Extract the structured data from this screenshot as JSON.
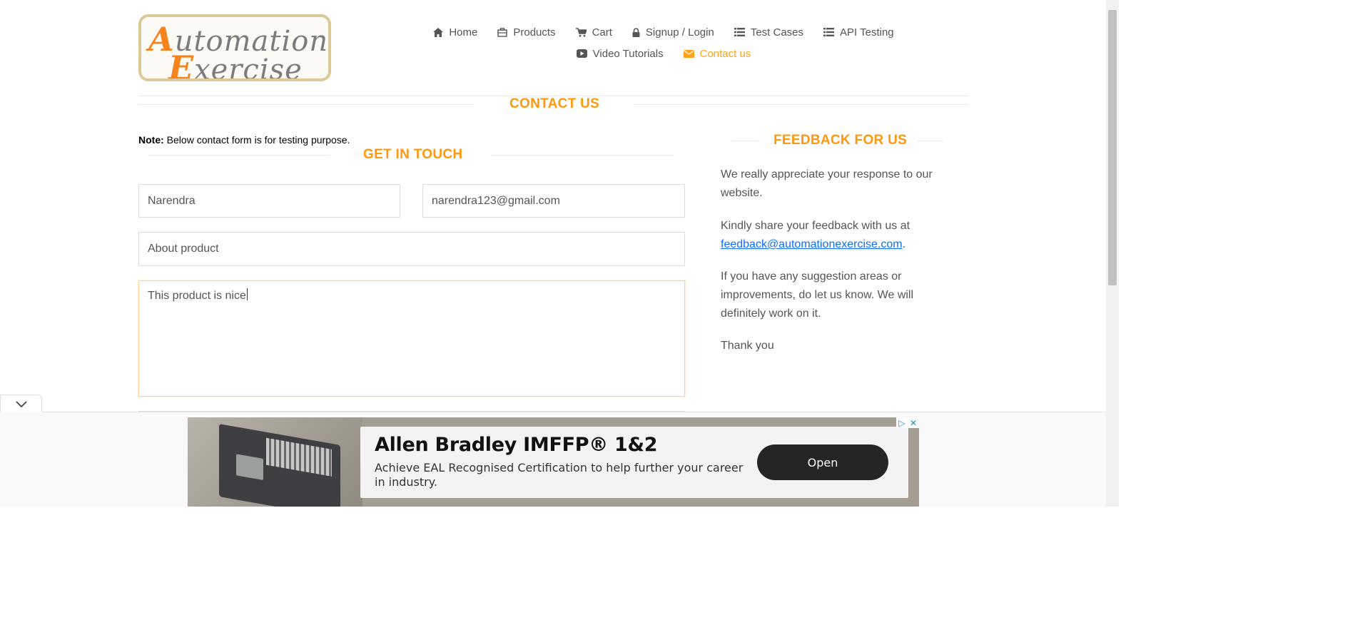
{
  "logo": {
    "line1_cap": "A",
    "line1_rest": "utomation",
    "line2_cap": "E",
    "line2_rest": "xercise"
  },
  "nav": {
    "row1": [
      {
        "label": "Home",
        "icon": "home-icon"
      },
      {
        "label": "Products",
        "icon": "products-icon"
      },
      {
        "label": "Cart",
        "icon": "cart-icon"
      },
      {
        "label": "Signup / Login",
        "icon": "lock-icon"
      },
      {
        "label": "Test Cases",
        "icon": "list-icon"
      },
      {
        "label": "API Testing",
        "icon": "list-icon"
      }
    ],
    "row2": [
      {
        "label": "Video Tutorials",
        "icon": "youtube-icon"
      },
      {
        "label": "Contact us",
        "icon": "envelope-icon",
        "active": true
      }
    ]
  },
  "page_title": "CONTACT US",
  "note": {
    "bold": "Note:",
    "text": " Below contact form is for testing purpose."
  },
  "form": {
    "title": "GET IN TOUCH",
    "name_value": "Narendra",
    "email_value": "narendra123@gmail.com",
    "subject_value": "About product",
    "message_value": "This product is nice"
  },
  "feedback": {
    "title": "FEEDBACK FOR US",
    "p1": "We really appreciate your response to our website.",
    "p2_text": "Kindly share your feedback with us at ",
    "p2_link": "feedback@automationexercise.com",
    "p2_end": ".",
    "p3": "If you have any suggestion areas or improvements, do let us know. We will definitely work on it.",
    "p4": "Thank you"
  },
  "ad": {
    "headline": "Allen Bradley IMFFP® 1&2",
    "body": "Achieve EAL Recognised Certification to help further your career in industry.",
    "button": "Open"
  },
  "colors": {
    "accent": "#FE980F",
    "link": "#0D6EFD",
    "text": "#555555"
  }
}
